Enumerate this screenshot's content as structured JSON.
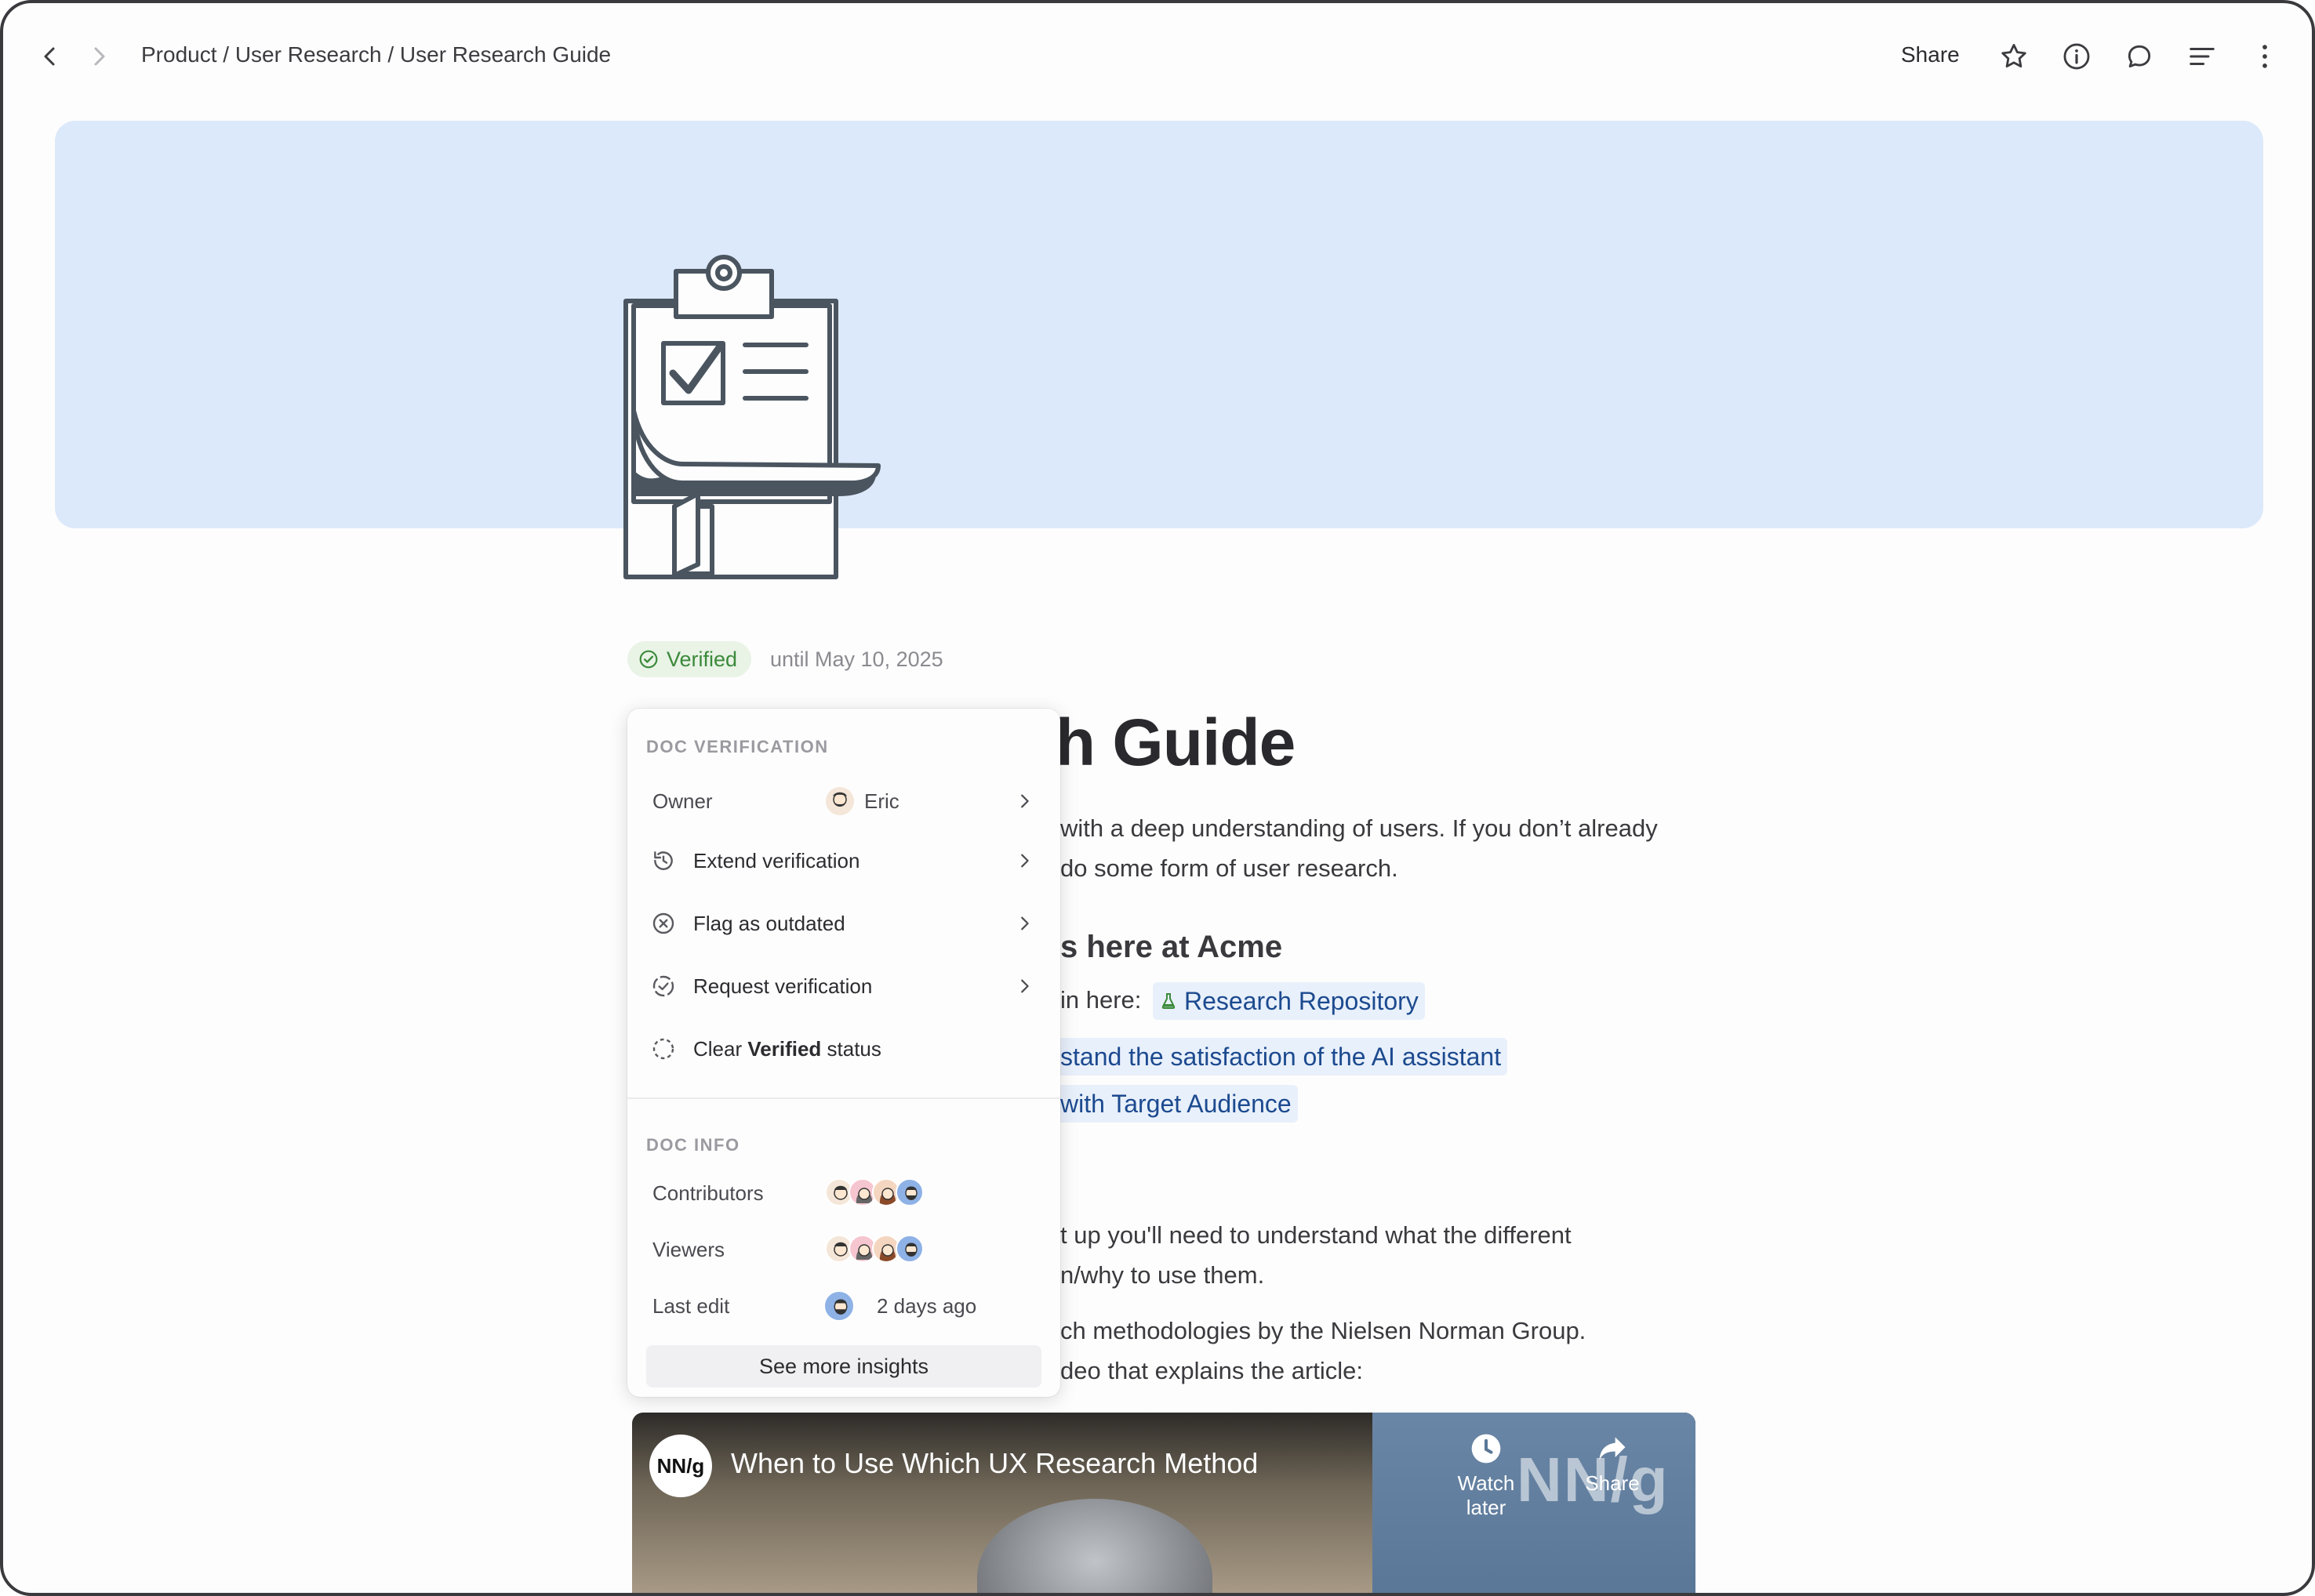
{
  "breadcrumb": "Product / User Research / User Research Guide",
  "toolbar": {
    "share_label": "Share",
    "icons": [
      "back-icon",
      "forward-icon",
      "star-icon",
      "info-icon",
      "comment-icon",
      "outline-icon",
      "more-icon"
    ]
  },
  "verification": {
    "badge_label": "Verified",
    "until_text": "until May 10, 2025"
  },
  "doc": {
    "title_fragment": "ch Guide",
    "para1_line1": "with a deep understanding of users. If you don’t already",
    "para1_line2": "do some form of user research.",
    "heading2": "s here at Acme",
    "para2": "in here:",
    "chip_repository": "Research Repository",
    "chip_ai": "stand the satisfaction of the AI assistant",
    "chip_target": "with Target Audience",
    "para3_line1": "t up you'll need to understand what the different",
    "para3_line2": "n/why to use them.",
    "para4_line1": "ch methodologies by the Nielsen Norman Group.",
    "para4_line2": "deo that explains the article:"
  },
  "popover": {
    "verification_section": "DOC VERIFICATION",
    "owner_label": "Owner",
    "owner_name": "Eric",
    "actions": {
      "extend": "Extend verification",
      "flag": "Flag as outdated",
      "request": "Request verification",
      "clear_prefix": "Clear ",
      "clear_bold": "Verified",
      "clear_suffix": " status"
    },
    "info_section": "DOC INFO",
    "contributors_label": "Contributors",
    "viewers_label": "Viewers",
    "last_edit_label": "Last edit",
    "last_edit_value": "2 days ago",
    "see_more": "See more insights"
  },
  "video": {
    "logo_text": "NN/g",
    "title": "When to Use Which UX Research Method",
    "watch_later": "Watch later",
    "share": "Share",
    "watermark": "NN/g"
  },
  "colors": {
    "cover": "#dce9fa",
    "verified_green": "#3b8a3b",
    "link_blue": "#1c4a8f",
    "chip_bg": "#e8f0fb"
  }
}
